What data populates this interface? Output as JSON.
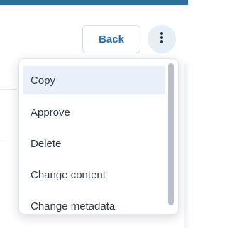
{
  "header": {
    "back_label": "Back"
  },
  "menu": {
    "items": [
      {
        "label": "Copy",
        "highlighted": true
      },
      {
        "label": "Approve",
        "highlighted": false
      },
      {
        "label": "Delete",
        "highlighted": false
      },
      {
        "label": "Change content",
        "highlighted": false
      },
      {
        "label": "Change metadata",
        "highlighted": false
      }
    ]
  },
  "icons": {
    "more": "more-vertical-icon"
  },
  "colors": {
    "accent": "#2f6f9f",
    "link": "#1f6fae",
    "highlight": "#e9f0fa",
    "more_button_bg": "#e6eef6"
  }
}
